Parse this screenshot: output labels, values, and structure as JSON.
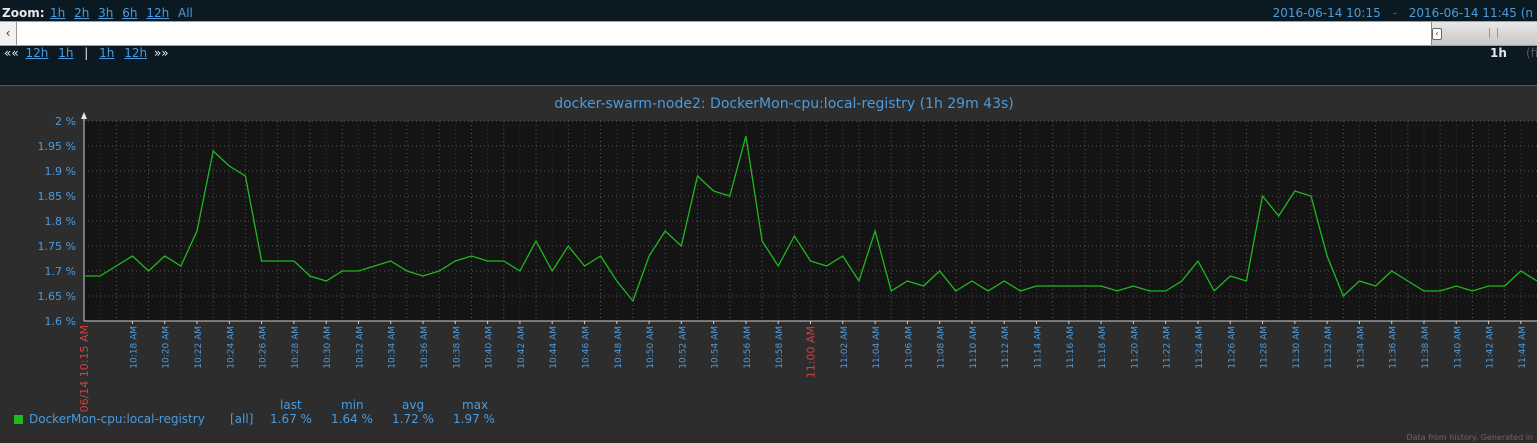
{
  "zoom": {
    "label": "Zoom:",
    "options": [
      "1h",
      "2h",
      "3h",
      "6h",
      "12h",
      "All"
    ]
  },
  "period": {
    "from": "2016-06-14 10:15",
    "separator": "-",
    "to": "2016-06-14 11:45 (n"
  },
  "navigation": {
    "back_arrows": "««",
    "back_links": [
      "12h",
      "1h"
    ],
    "divider": "|",
    "forward_links": [
      "1h",
      "12h"
    ],
    "forward_arrows": "»»",
    "period_length": "1h",
    "fixed_toggle": "(fi"
  },
  "chart_data": {
    "type": "line",
    "title": "docker-swarm-node2: DockerMon-cpu:local-registry (1h 29m 43s)",
    "ylim": [
      1.6,
      2.0
    ],
    "y_ticks": [
      "1.6 %",
      "1.65 %",
      "1.7 %",
      "1.75 %",
      "1.8 %",
      "1.85 %",
      "1.9 %",
      "1.95 %",
      "2 %"
    ],
    "x_start_label": "06/14 10:15 AM",
    "x_labels": [
      "10:18 AM",
      "10:20 AM",
      "10:22 AM",
      "10:24 AM",
      "10:26 AM",
      "10:28 AM",
      "10:30 AM",
      "10:32 AM",
      "10:34 AM",
      "10:36 AM",
      "10:38 AM",
      "10:40 AM",
      "10:42 AM",
      "10:44 AM",
      "10:46 AM",
      "10:48 AM",
      "10:50 AM",
      "10:52 AM",
      "10:54 AM",
      "10:56 AM",
      "10:58 AM",
      "11:00 AM",
      "11:02 AM",
      "11:04 AM",
      "11:06 AM",
      "11:08 AM",
      "11:10 AM",
      "11:12 AM",
      "11:14 AM",
      "11:16 AM",
      "11:18 AM",
      "11:20 AM",
      "11:22 AM",
      "11:24 AM",
      "11:26 AM",
      "11:28 AM",
      "11:30 AM",
      "11:32 AM",
      "11:34 AM",
      "11:36 AM",
      "11:38 AM",
      "11:40 AM",
      "11:42 AM",
      "11:44 AM"
    ],
    "highlight_labels": [
      "11:00 AM"
    ],
    "grid": true,
    "colors": {
      "series": "#1fb81f",
      "axis_label": "#4a9be0",
      "highlight_label": "#d04040",
      "plot_bg": "#141414"
    },
    "series": [
      {
        "name": "DockerMon-cpu:local-registry",
        "x_minutes": [
          15,
          16,
          18,
          19,
          20,
          21,
          22,
          23,
          24,
          25,
          26,
          27,
          28,
          29,
          30,
          31,
          32,
          33,
          34,
          35,
          36,
          37,
          38,
          39,
          40,
          41,
          42,
          43,
          44,
          45,
          46,
          47,
          48,
          49,
          50,
          51,
          52,
          53,
          54,
          55,
          56,
          57,
          58,
          59,
          60,
          61,
          62,
          63,
          64,
          65,
          66,
          67,
          68,
          69,
          70,
          71,
          72,
          73,
          74,
          75,
          76,
          77,
          78,
          79,
          80,
          81,
          82,
          83,
          84,
          85,
          86,
          87,
          88,
          89,
          90,
          91,
          92,
          93,
          94,
          95,
          96,
          97,
          98,
          99,
          100,
          101,
          102,
          103,
          104,
          105
        ],
        "values": [
          1.69,
          1.69,
          1.73,
          1.7,
          1.73,
          1.71,
          1.78,
          1.94,
          1.91,
          1.89,
          1.72,
          1.72,
          1.72,
          1.69,
          1.68,
          1.7,
          1.7,
          1.71,
          1.72,
          1.7,
          1.69,
          1.7,
          1.72,
          1.73,
          1.72,
          1.72,
          1.7,
          1.76,
          1.7,
          1.75,
          1.71,
          1.73,
          1.68,
          1.64,
          1.73,
          1.78,
          1.75,
          1.89,
          1.86,
          1.85,
          1.97,
          1.76,
          1.71,
          1.77,
          1.72,
          1.71,
          1.73,
          1.68,
          1.78,
          1.66,
          1.68,
          1.67,
          1.7,
          1.66,
          1.68,
          1.66,
          1.68,
          1.66,
          1.67,
          1.67,
          1.67,
          1.67,
          1.67,
          1.66,
          1.67,
          1.66,
          1.66,
          1.68,
          1.72,
          1.66,
          1.69,
          1.68,
          1.85,
          1.81,
          1.86,
          1.85,
          1.73,
          1.65,
          1.68,
          1.67,
          1.7,
          1.68,
          1.66,
          1.66,
          1.67,
          1.66,
          1.67,
          1.67,
          1.7,
          1.68
        ]
      }
    ],
    "x_range": [
      15,
      105
    ]
  },
  "legend": {
    "headers": {
      "last": "last",
      "min": "min",
      "avg": "avg",
      "max": "max"
    },
    "rows": [
      {
        "name": "DockerMon-cpu:local-registry",
        "func": "[all]",
        "last": "1.67 %",
        "min": "1.64 %",
        "avg": "1.72 %",
        "max": "1.97 %"
      }
    ]
  },
  "footer": "Data from history. Generated in"
}
